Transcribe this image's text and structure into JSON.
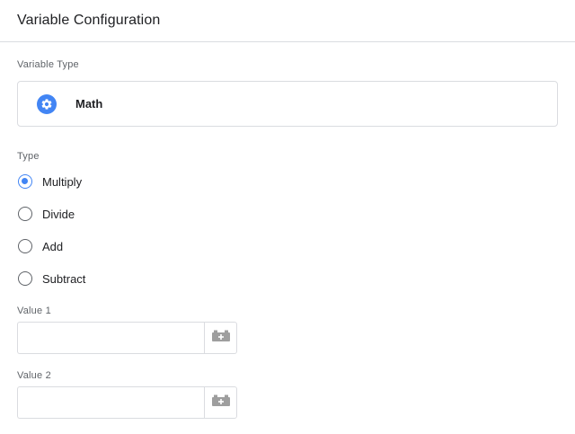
{
  "header": {
    "title": "Variable Configuration"
  },
  "variable_type": {
    "label": "Variable Type",
    "selected_name": "Math",
    "icon": "gear-icon",
    "icon_color": "#4285f4"
  },
  "type_section": {
    "label": "Type",
    "options": [
      {
        "label": "Multiply",
        "selected": true
      },
      {
        "label": "Divide",
        "selected": false
      },
      {
        "label": "Add",
        "selected": false
      },
      {
        "label": "Subtract",
        "selected": false
      }
    ]
  },
  "value1": {
    "label": "Value 1",
    "value": "",
    "button_icon": "variable-picker-icon"
  },
  "value2": {
    "label": "Value 2",
    "value": "",
    "button_icon": "variable-picker-icon"
  },
  "colors": {
    "accent": "#4285f4",
    "border": "#dadce0",
    "label_gray": "#5f6368",
    "icon_gray": "#9e9e9e"
  }
}
